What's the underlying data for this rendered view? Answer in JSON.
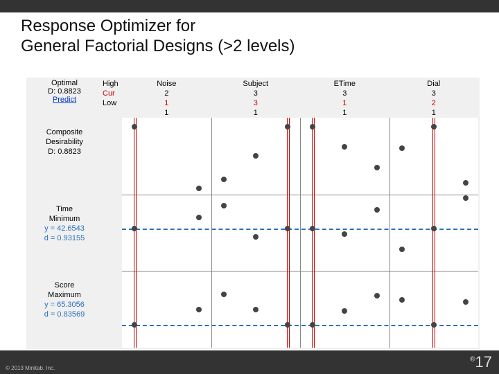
{
  "title_line1": "Response Optimizer for",
  "title_line2": "General Factorial Designs (>2 levels)",
  "footer": {
    "copyright": "© 2013 Minitab. Inc.",
    "page": "17",
    "reg": "®"
  },
  "header": {
    "optimal": "Optimal",
    "d_label": "D: 0.8823",
    "predict": "Predict",
    "high": "High",
    "cur": "Cur",
    "low": "Low"
  },
  "factors": [
    {
      "name": "Noise",
      "max": "2",
      "cur": "1",
      "min": "1",
      "levels": 2,
      "cur_idx": 0
    },
    {
      "name": "Subject",
      "max": "3",
      "cur": "3",
      "min": "1",
      "levels": 3,
      "cur_idx": 2
    },
    {
      "name": "ETime",
      "max": "3",
      "cur": "1",
      "min": "1",
      "levels": 3,
      "cur_idx": 0
    },
    {
      "name": "Dial",
      "max": "3",
      "cur": "2",
      "min": "1",
      "levels": 3,
      "cur_idx": 1
    }
  ],
  "rows": [
    {
      "l1": "Composite",
      "l2": "Desirability",
      "l3": "D: 0.8823",
      "l4": "",
      "l5": "",
      "blue": [],
      "dash": null
    },
    {
      "l1": "Time",
      "l2": "Minimum",
      "l3": "",
      "l4": "y = 42.6543",
      "l5": "d = 0.93155",
      "blue": [
        3,
        4
      ],
      "dash": 0.55
    },
    {
      "l1": "Score",
      "l2": "Maximum",
      "l3": "",
      "l4": "y = 65.3056",
      "l5": "d = 0.83569",
      "blue": [
        3,
        4
      ],
      "dash": 0.3
    }
  ],
  "chart_data": {
    "type": "table",
    "title": "Response Optimizer — General Factorial",
    "factors": [
      "Noise",
      "Subject",
      "ETime",
      "Dial"
    ],
    "factor_levels": {
      "Noise": [
        1,
        2
      ],
      "Subject": [
        1,
        2,
        3
      ],
      "ETime": [
        1,
        2,
        3
      ],
      "Dial": [
        1,
        2,
        3
      ]
    },
    "current_settings": {
      "Noise": 1,
      "Subject": 3,
      "ETime": 1,
      "Dial": 2
    },
    "overall_desirability": 0.8823,
    "responses": [
      {
        "name": "Time",
        "goal": "Minimum",
        "y": 42.6543,
        "d": 0.93155
      },
      {
        "name": "Score",
        "goal": "Maximum",
        "y": 65.3056,
        "d": 0.83569
      }
    ],
    "points_norm": {
      "Composite": {
        "Noise": [
          0.88,
          0.08
        ],
        "Subject": [
          0.2,
          0.5,
          0.88
        ],
        "ETime": [
          0.88,
          0.62,
          0.35
        ],
        "Dial": [
          0.6,
          0.88,
          0.15
        ]
      },
      "Time": {
        "Noise": [
          0.55,
          0.7
        ],
        "Subject": [
          0.85,
          0.45,
          0.55
        ],
        "ETime": [
          0.55,
          0.48,
          0.8
        ],
        "Dial": [
          0.28,
          0.55,
          0.95
        ]
      },
      "Score": {
        "Noise": [
          0.3,
          0.5
        ],
        "Subject": [
          0.7,
          0.5,
          0.3
        ],
        "ETime": [
          0.3,
          0.48,
          0.68
        ],
        "Dial": [
          0.62,
          0.3,
          0.6
        ]
      }
    }
  }
}
